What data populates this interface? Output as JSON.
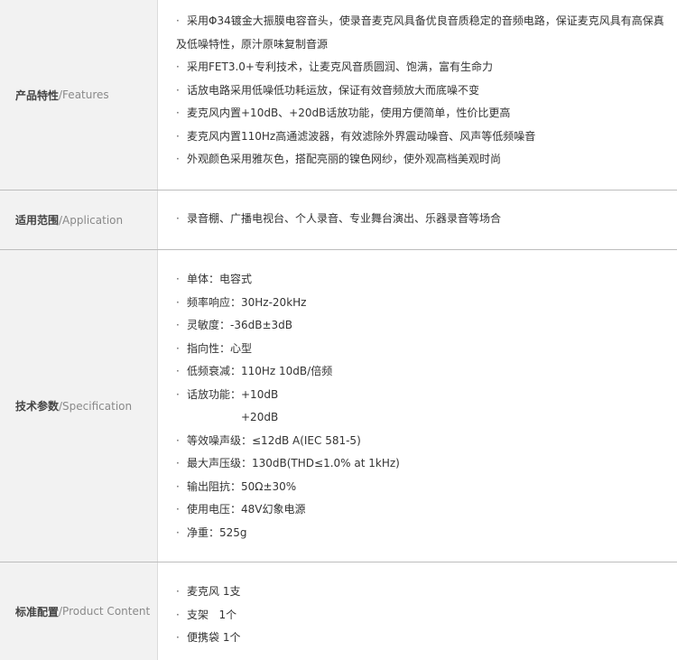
{
  "rows": [
    {
      "label_zh": "产品特性",
      "label_en": "/Features",
      "lines": [
        "采用Φ34镀金大振膜电容音头，使录音麦克风具备优良音质稳定的音频电路，保证麦克风具有高保真",
        "及低噪特性，原汁原味复制音源",
        "采用FET3.0+专利技术，让麦克风音质圆润、饱满，富有生命力",
        "话放电路采用低噪低功耗运放，保证有效音频放大而底噪不变",
        "麦克风内置+10dB、+20dB话放功能，使用方便简单，性价比更高",
        "麦克风内置110Hz高通滤波器，有效滤除外界震动噪音、风声等低频噪音",
        "外观颜色采用雅灰色，搭配亮丽的镍色网纱，使外观高档美观时尚"
      ]
    },
    {
      "label_zh": "适用范围",
      "label_en": "/Application",
      "lines": [
        "录音棚、广播电视台、个人录音、专业舞台演出、乐器录音等场合"
      ]
    },
    {
      "label_zh": "技术参数",
      "label_en": "/Specification",
      "lines": [
        "单体：电容式",
        "频率响应：30Hz-20kHz",
        "灵敏度：-36dB±3dB",
        "指向性：心型",
        "低频衰减：110Hz 10dB/倍频",
        "话放功能：+10dB",
        "+20dB",
        "等效噪声级：≤12dB A(IEC 581-5)",
        "最大声压级：130dB(THD≤1.0% at 1kHz)",
        "输出阻抗：50Ω±30%",
        "使用电压：48V幻象电源",
        "净重：525g"
      ]
    },
    {
      "label_zh": "标准配置",
      "label_en": "/Product Content",
      "lines": [
        "麦克风 1支",
        "支架   1个",
        "便携袋 1个"
      ]
    }
  ],
  "bullet_char": "·"
}
